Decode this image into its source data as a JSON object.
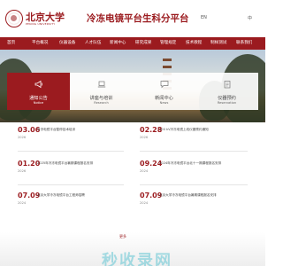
{
  "header": {
    "logo_cn": "北京大学",
    "logo_en": "PEKING UNIVERSITY",
    "title": "冷冻电镜平台生科分平台",
    "lang_en": "EN",
    "lang_cn": "中"
  },
  "nav": {
    "items": [
      "首页",
      "平台概况",
      "仪器设备",
      "人才队伍",
      "新闻中心",
      "研究成果",
      "管理规定",
      "技术教程",
      "制样测试",
      "联系我们"
    ]
  },
  "tabs": [
    {
      "cn": "通知公告",
      "en": "Notice",
      "icon": "megaphone-icon"
    },
    {
      "cn": "讲座与培训",
      "en": "Research",
      "icon": "laptop-icon"
    },
    {
      "cn": "新闻中心",
      "en": "News",
      "icon": "chat-icon"
    },
    {
      "cn": "仪器预约",
      "en": "Reservation",
      "icon": "clipboard-icon"
    }
  ],
  "news": {
    "left": [
      {
        "date": "03.06",
        "year": "2026",
        "text": "冷冻电镜平台暂停技术培训"
      },
      {
        "date": "01.20",
        "year": "2026",
        "text": "2025年冷冻电镜平台暑期课程报名安排"
      },
      {
        "date": "07.09",
        "year": "2024",
        "text": "北京大学冷冻电镜平台工程师招聘"
      }
    ],
    "right": [
      {
        "date": "02.28",
        "year": "2026",
        "text": "200 kV冷冻电镜上线仪器预约通知"
      },
      {
        "date": "09.24",
        "year": "2024",
        "text": "2024年冷冻电镜平台北十一期课程报名安排"
      },
      {
        "date": "07.09",
        "year": "2024",
        "text": "北京大学冷冻电镜平台暑期课程报名安排"
      }
    ]
  },
  "footer": {
    "more": "更多",
    "watermark": "秒收录网"
  },
  "colors": {
    "brand": "#9b1b1f"
  }
}
